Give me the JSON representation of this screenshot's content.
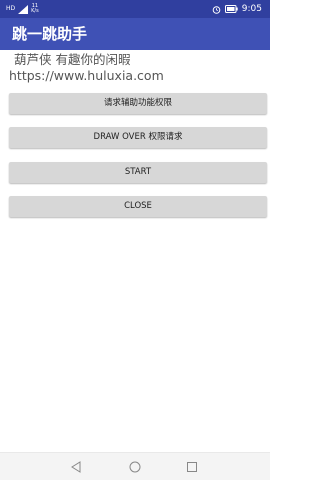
{
  "status_bar": {
    "carrier_signal": "HD",
    "net_speed_value": "11",
    "net_speed_unit": "K/s",
    "time": "9:05",
    "icons": [
      "hd-icon",
      "signal-icon",
      "alarm-icon",
      "battery-icon"
    ],
    "background": "#303F9F"
  },
  "action_bar": {
    "title": "跳一跳助手",
    "background": "#3F51B5"
  },
  "content": {
    "line1": "葫芦侠 有趣你的闲暇",
    "line2": "https://www.huluxia.com"
  },
  "buttons": {
    "accessibility": "请求辅助功能权限",
    "draw_over": "DRAW OVER 权限请求",
    "start": "START",
    "close": "CLOSE"
  },
  "nav_bar": {
    "icons": [
      "back-icon",
      "home-icon",
      "recent-apps-icon"
    ]
  }
}
